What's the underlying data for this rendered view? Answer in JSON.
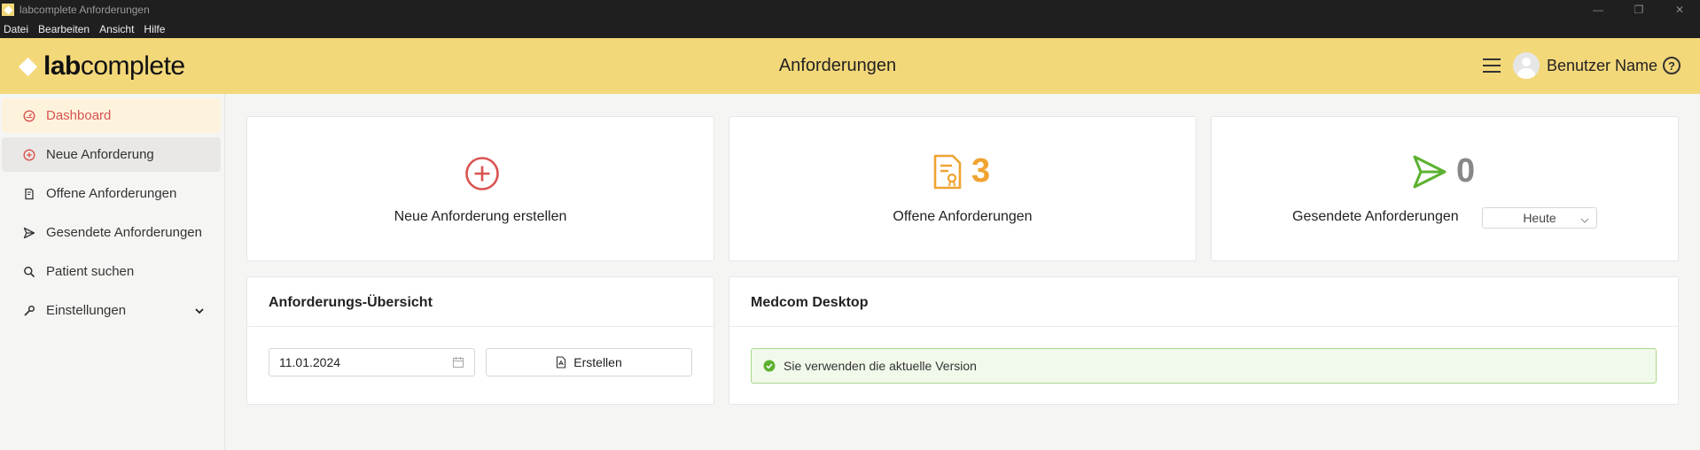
{
  "window": {
    "title": "labcomplete Anforderungen",
    "controls": {
      "minimize": "—",
      "restore": "❐",
      "close": "✕"
    }
  },
  "menu": [
    "Datei",
    "Bearbeiten",
    "Ansicht",
    "Hilfe"
  ],
  "header": {
    "logo_bold": "lab",
    "logo_rest": "complete",
    "title": "Anforderungen",
    "username": "Benutzer Name",
    "help": "?"
  },
  "sidebar": {
    "items": [
      {
        "label": "Dashboard",
        "icon": "dashboard-icon"
      },
      {
        "label": "Neue Anforderung",
        "icon": "plus-circle-icon"
      },
      {
        "label": "Offene Anforderungen",
        "icon": "document-icon"
      },
      {
        "label": "Gesendete Anforderungen",
        "icon": "send-icon"
      },
      {
        "label": "Patient suchen",
        "icon": "search-icon"
      },
      {
        "label": "Einstellungen",
        "icon": "wrench-icon"
      }
    ]
  },
  "stats": {
    "new": {
      "label": "Neue Anforderung erstellen"
    },
    "open": {
      "count": "3",
      "label": "Offene Anforderungen"
    },
    "sent": {
      "count": "0",
      "label": "Gesendete Anforderungen",
      "period": "Heute"
    }
  },
  "overview": {
    "title": "Anforderungs-Übersicht",
    "date": "11.01.2024",
    "button": "Erstellen"
  },
  "medcom": {
    "title": "Medcom Desktop",
    "status": "Sie verwenden die aktuelle Version"
  },
  "colors": {
    "header_bg": "#f3d87a",
    "red": "#d9534f",
    "orange": "#f0a330",
    "green": "#5cb130",
    "gray_number": "#888888"
  }
}
